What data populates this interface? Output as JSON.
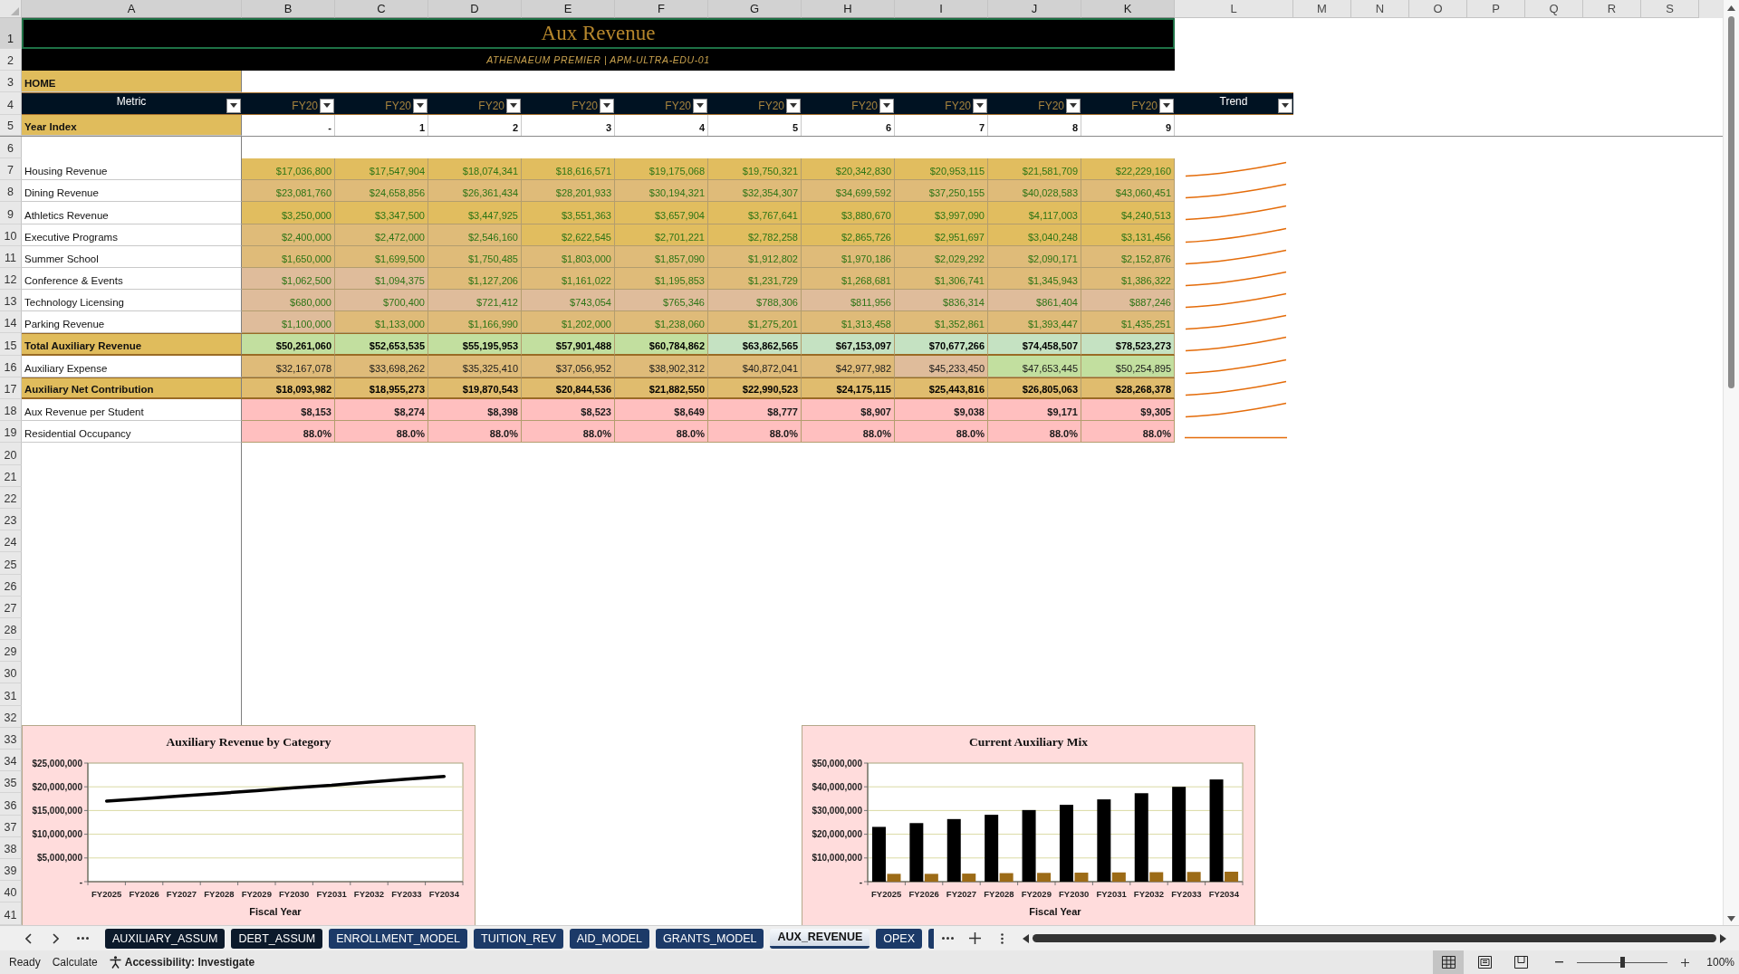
{
  "column_headers": [
    {
      "label": "A",
      "selected": true
    },
    {
      "label": "B",
      "selected": true
    },
    {
      "label": "C",
      "selected": true
    },
    {
      "label": "D",
      "selected": true
    },
    {
      "label": "E",
      "selected": true
    },
    {
      "label": "F",
      "selected": true
    },
    {
      "label": "G",
      "selected": true
    },
    {
      "label": "H",
      "selected": true
    },
    {
      "label": "I",
      "selected": true
    },
    {
      "label": "J",
      "selected": true
    },
    {
      "label": "K",
      "selected": true
    },
    {
      "label": "L",
      "selected": false
    },
    {
      "label": "M",
      "selected": false
    },
    {
      "label": "N",
      "selected": false
    },
    {
      "label": "O",
      "selected": false
    },
    {
      "label": "P",
      "selected": false
    },
    {
      "label": "Q",
      "selected": false
    },
    {
      "label": "R",
      "selected": false
    },
    {
      "label": "S",
      "selected": false
    }
  ],
  "row_headers": [
    {
      "label": "1",
      "selected": true
    },
    {
      "label": "2",
      "selected": false
    },
    {
      "label": "3",
      "selected": false
    },
    {
      "label": "4",
      "selected": false
    },
    {
      "label": "5",
      "selected": false
    },
    {
      "label": "6",
      "selected": false
    },
    {
      "label": "7",
      "selected": false
    },
    {
      "label": "8",
      "selected": false
    },
    {
      "label": "9",
      "selected": false
    },
    {
      "label": "10",
      "selected": false
    },
    {
      "label": "11",
      "selected": false
    },
    {
      "label": "12",
      "selected": false
    },
    {
      "label": "13",
      "selected": false
    },
    {
      "label": "14",
      "selected": false
    },
    {
      "label": "15",
      "selected": false
    },
    {
      "label": "16",
      "selected": false
    },
    {
      "label": "17",
      "selected": false
    },
    {
      "label": "18",
      "selected": false
    },
    {
      "label": "19",
      "selected": false
    },
    {
      "label": "20",
      "selected": false
    },
    {
      "label": "21",
      "selected": false
    },
    {
      "label": "22",
      "selected": false
    },
    {
      "label": "23",
      "selected": false
    },
    {
      "label": "24",
      "selected": false
    },
    {
      "label": "25",
      "selected": false
    },
    {
      "label": "26",
      "selected": false
    },
    {
      "label": "27",
      "selected": false
    },
    {
      "label": "28",
      "selected": false
    },
    {
      "label": "29",
      "selected": false
    },
    {
      "label": "30",
      "selected": false
    },
    {
      "label": "31",
      "selected": false
    },
    {
      "label": "32",
      "selected": false
    },
    {
      "label": "33",
      "selected": false
    },
    {
      "label": "34",
      "selected": false
    },
    {
      "label": "35",
      "selected": false
    },
    {
      "label": "36",
      "selected": false
    },
    {
      "label": "37",
      "selected": false
    },
    {
      "label": "38",
      "selected": false
    },
    {
      "label": "39",
      "selected": false
    },
    {
      "label": "40",
      "selected": false
    },
    {
      "label": "41",
      "selected": false
    }
  ],
  "title": {
    "text": "Aux Revenue",
    "selected": true
  },
  "subtitle": "ATHENAEUM PREMIER | APM-ULTRA-EDU-01",
  "home": "HOME",
  "table": {
    "metric_header": "Metric",
    "columns": [
      "FY20",
      "FY20",
      "FY20",
      "FY20",
      "FY20",
      "FY20",
      "FY20",
      "FY20",
      "FY20",
      "FY20"
    ],
    "trend_header": "Trend",
    "year_index": {
      "label": "Year Index",
      "values": [
        "-",
        "1",
        "2",
        "3",
        "4",
        "5",
        "6",
        "7",
        "8",
        "9"
      ]
    },
    "rows": [
      {
        "label": "Housing Revenue",
        "kind": "input",
        "trend_flat": false,
        "cells": [
          {
            "value": "$17,036,800",
            "color": "#e1bd5f"
          },
          {
            "value": "$17,547,904",
            "color": "#e1bd5f"
          },
          {
            "value": "$18,074,341",
            "color": "#e1bd5f"
          },
          {
            "value": "$18,616,571",
            "color": "#e1bd5f"
          },
          {
            "value": "$19,175,068",
            "color": "#e1bd5f"
          },
          {
            "value": "$19,750,321",
            "color": "#e1bd5f"
          },
          {
            "value": "$20,342,830",
            "color": "#e1bd5f"
          },
          {
            "value": "$20,953,115",
            "color": "#e1bd5f"
          },
          {
            "value": "$21,581,709",
            "color": "#e1bd5f"
          },
          {
            "value": "$22,229,160",
            "color": "#e1bd5f"
          }
        ]
      },
      {
        "label": "Dining Revenue",
        "kind": "input",
        "trend_flat": false,
        "cells": [
          {
            "value": "$23,081,760",
            "color": "#dfbb79"
          },
          {
            "value": "$24,658,856",
            "color": "#dfbb79"
          },
          {
            "value": "$26,361,434",
            "color": "#dfbb79"
          },
          {
            "value": "$28,201,933",
            "color": "#dfbb79"
          },
          {
            "value": "$30,194,321",
            "color": "#dfbb79"
          },
          {
            "value": "$32,354,307",
            "color": "#dfbb79"
          },
          {
            "value": "$34,699,592",
            "color": "#dfbb79"
          },
          {
            "value": "$37,250,155",
            "color": "#dfbb79"
          },
          {
            "value": "$40,028,583",
            "color": "#dfbb79"
          },
          {
            "value": "$43,060,451",
            "color": "#dfbb79"
          }
        ]
      },
      {
        "label": "Athletics Revenue",
        "kind": "input",
        "trend_flat": false,
        "cells": [
          {
            "value": "$3,250,000",
            "color": "#e1bd5f"
          },
          {
            "value": "$3,347,500",
            "color": "#e1bd5f"
          },
          {
            "value": "$3,447,925",
            "color": "#e1bd5f"
          },
          {
            "value": "$3,551,363",
            "color": "#e1bd5f"
          },
          {
            "value": "$3,657,904",
            "color": "#e1bd5f"
          },
          {
            "value": "$3,767,641",
            "color": "#e1bd5f"
          },
          {
            "value": "$3,880,670",
            "color": "#e1bd5f"
          },
          {
            "value": "$3,997,090",
            "color": "#e1bd5f"
          },
          {
            "value": "$4,117,003",
            "color": "#e1bd5f"
          },
          {
            "value": "$4,240,513",
            "color": "#e1bd5f"
          }
        ]
      },
      {
        "label": "Executive Programs",
        "kind": "input",
        "trend_flat": false,
        "cells": [
          {
            "value": "$2,400,000",
            "color": "#dfbb79"
          },
          {
            "value": "$2,472,000",
            "color": "#dfbb79"
          },
          {
            "value": "$2,546,160",
            "color": "#dfbb79"
          },
          {
            "value": "$2,622,545",
            "color": "#e1bd5f"
          },
          {
            "value": "$2,701,221",
            "color": "#e1bd5f"
          },
          {
            "value": "$2,782,258",
            "color": "#e1bd5f"
          },
          {
            "value": "$2,865,726",
            "color": "#e1bd5f"
          },
          {
            "value": "$2,951,697",
            "color": "#e1bd5f"
          },
          {
            "value": "$3,040,248",
            "color": "#e1bd5f"
          },
          {
            "value": "$3,131,456",
            "color": "#e1bd5f"
          }
        ]
      },
      {
        "label": "Summer School",
        "kind": "input",
        "trend_flat": false,
        "cells": [
          {
            "value": "$1,650,000",
            "color": "#dfbb79"
          },
          {
            "value": "$1,699,500",
            "color": "#dfbb79"
          },
          {
            "value": "$1,750,485",
            "color": "#dfbb79"
          },
          {
            "value": "$1,803,000",
            "color": "#dfbb79"
          },
          {
            "value": "$1,857,090",
            "color": "#dfbb79"
          },
          {
            "value": "$1,912,802",
            "color": "#dfbb79"
          },
          {
            "value": "$1,970,186",
            "color": "#dfbb79"
          },
          {
            "value": "$2,029,292",
            "color": "#dfbb79"
          },
          {
            "value": "$2,090,171",
            "color": "#dfbb79"
          },
          {
            "value": "$2,152,876",
            "color": "#dfbb79"
          }
        ]
      },
      {
        "label": "Conference & Events",
        "kind": "input",
        "trend_flat": false,
        "cells": [
          {
            "value": "$1,062,500",
            "color": "#dfbc9b"
          },
          {
            "value": "$1,094,375",
            "color": "#dfbc9b"
          },
          {
            "value": "$1,127,206",
            "color": "#dfbb79"
          },
          {
            "value": "$1,161,022",
            "color": "#dfbb79"
          },
          {
            "value": "$1,195,853",
            "color": "#dfbb79"
          },
          {
            "value": "$1,231,729",
            "color": "#dfbb79"
          },
          {
            "value": "$1,268,681",
            "color": "#dfbb79"
          },
          {
            "value": "$1,306,741",
            "color": "#dfbb79"
          },
          {
            "value": "$1,345,943",
            "color": "#dfbb79"
          },
          {
            "value": "$1,386,322",
            "color": "#dfbb79"
          }
        ]
      },
      {
        "label": "Technology Licensing",
        "kind": "input",
        "trend_flat": false,
        "cells": [
          {
            "value": "$680,000",
            "color": "#dfbc9b"
          },
          {
            "value": "$700,400",
            "color": "#dfbc9b"
          },
          {
            "value": "$721,412",
            "color": "#dfbc9b"
          },
          {
            "value": "$743,054",
            "color": "#dfbc9b"
          },
          {
            "value": "$765,346",
            "color": "#dfbc9b"
          },
          {
            "value": "$788,306",
            "color": "#dfbc9b"
          },
          {
            "value": "$811,956",
            "color": "#dfbc9b"
          },
          {
            "value": "$836,314",
            "color": "#dfbc9b"
          },
          {
            "value": "$861,404",
            "color": "#dfbc9b"
          },
          {
            "value": "$887,246",
            "color": "#dfbc9b"
          }
        ]
      },
      {
        "label": "Parking Revenue",
        "kind": "input",
        "trend_flat": false,
        "cells": [
          {
            "value": "$1,100,000",
            "color": "#dfbc9b"
          },
          {
            "value": "$1,133,000",
            "color": "#dfbb79"
          },
          {
            "value": "$1,166,990",
            "color": "#dfbb79"
          },
          {
            "value": "$1,202,000",
            "color": "#dfbb79"
          },
          {
            "value": "$1,238,060",
            "color": "#dfbb79"
          },
          {
            "value": "$1,275,201",
            "color": "#dfbb79"
          },
          {
            "value": "$1,313,458",
            "color": "#dfbb79"
          },
          {
            "value": "$1,352,861",
            "color": "#dfbb79"
          },
          {
            "value": "$1,393,447",
            "color": "#dfbb79"
          },
          {
            "value": "$1,435,251",
            "color": "#dfbb79"
          }
        ]
      },
      {
        "label": "Total Auxiliary Revenue",
        "kind": "total",
        "trend_flat": false,
        "cells": [
          {
            "value": "$50,261,060",
            "color": "#c2df9f"
          },
          {
            "value": "$52,653,535",
            "color": "#c2df9f"
          },
          {
            "value": "$55,195,953",
            "color": "#c2df9f"
          },
          {
            "value": "$57,901,488",
            "color": "#c2df9f"
          },
          {
            "value": "$60,784,862",
            "color": "#c2df9f"
          },
          {
            "value": "$63,862,565",
            "color": "#c5e2c2"
          },
          {
            "value": "$67,153,097",
            "color": "#c5e2c2"
          },
          {
            "value": "$70,677,266",
            "color": "#c5e2c2"
          },
          {
            "value": "$74,458,507",
            "color": "#c5e2c2"
          },
          {
            "value": "$78,523,273",
            "color": "#c5e2c2"
          }
        ]
      },
      {
        "label": "Auxiliary Expense",
        "kind": "calc",
        "trend_flat": false,
        "cells": [
          {
            "value": "$32,167,078",
            "color": "#dfbb79"
          },
          {
            "value": "$33,698,262",
            "color": "#dfbb79"
          },
          {
            "value": "$35,325,410",
            "color": "#dfbb79"
          },
          {
            "value": "$37,056,952",
            "color": "#dfbb79"
          },
          {
            "value": "$38,902,312",
            "color": "#dfbb79"
          },
          {
            "value": "$40,872,041",
            "color": "#dfbb79"
          },
          {
            "value": "$42,977,982",
            "color": "#dfbb79"
          },
          {
            "value": "$45,233,450",
            "color": "#dfbc9b"
          },
          {
            "value": "$47,653,445",
            "color": "#c2df9f"
          },
          {
            "value": "$50,254,895",
            "color": "#c2df9f"
          }
        ]
      },
      {
        "label": "Auxiliary Net Contribution",
        "kind": "total",
        "trend_flat": false,
        "cells": [
          {
            "value": "$18,093,982",
            "color": "#e0bc6e"
          },
          {
            "value": "$18,955,273",
            "color": "#e0bc6e"
          },
          {
            "value": "$19,870,543",
            "color": "#e0bc6e"
          },
          {
            "value": "$20,844,536",
            "color": "#e0bc6e"
          },
          {
            "value": "$21,882,550",
            "color": "#e0bc6e"
          },
          {
            "value": "$22,990,523",
            "color": "#e0bc6e"
          },
          {
            "value": "$24,175,115",
            "color": "#e0bc6e"
          },
          {
            "value": "$25,443,816",
            "color": "#e0bc6e"
          },
          {
            "value": "$26,805,063",
            "color": "#e0bc6e"
          },
          {
            "value": "$28,268,378",
            "color": "#e0bc6e"
          }
        ]
      },
      {
        "label": "Aux Revenue per Student",
        "kind": "metric",
        "trend_flat": false,
        "cells": [
          {
            "value": "$8,153",
            "color": "#ffbfbf"
          },
          {
            "value": "$8,274",
            "color": "#ffbfbf"
          },
          {
            "value": "$8,398",
            "color": "#ffbfbf"
          },
          {
            "value": "$8,523",
            "color": "#ffbfbf"
          },
          {
            "value": "$8,649",
            "color": "#ffbfbf"
          },
          {
            "value": "$8,777",
            "color": "#ffbfbf"
          },
          {
            "value": "$8,907",
            "color": "#ffbfbf"
          },
          {
            "value": "$9,038",
            "color": "#ffbfbf"
          },
          {
            "value": "$9,171",
            "color": "#ffbfbf"
          },
          {
            "value": "$9,305",
            "color": "#ffbfbf"
          }
        ]
      },
      {
        "label": "Residential Occupancy",
        "kind": "metric",
        "trend_flat": true,
        "cells": [
          {
            "value": "88.0%",
            "color": "#ffbfbf"
          },
          {
            "value": "88.0%",
            "color": "#ffbfbf"
          },
          {
            "value": "88.0%",
            "color": "#ffbfbf"
          },
          {
            "value": "88.0%",
            "color": "#ffbfbf"
          },
          {
            "value": "88.0%",
            "color": "#ffbfbf"
          },
          {
            "value": "88.0%",
            "color": "#ffbfbf"
          },
          {
            "value": "88.0%",
            "color": "#ffbfbf"
          },
          {
            "value": "88.0%",
            "color": "#ffbfbf"
          },
          {
            "value": "88.0%",
            "color": "#ffbfbf"
          },
          {
            "value": "88.0%",
            "color": "#ffbfbf"
          }
        ]
      }
    ]
  },
  "charts": [
    {
      "chart_data": {
        "type": "line",
        "title": "Auxiliary Revenue by Category",
        "xlabel": "Fiscal Year",
        "categories": [
          "FY2025",
          "FY2026",
          "FY2027",
          "FY2028",
          "FY2029",
          "FY2030",
          "FY2031",
          "FY2032",
          "FY2033",
          "FY2034"
        ],
        "series": [
          {
            "color": "#000000",
            "values": [
              17000000,
              17500000,
              18100000,
              18600000,
              19200000,
              19800000,
              20300000,
              21000000,
              21600000,
              22200000
            ]
          }
        ],
        "ylim": [
          0,
          25000000
        ],
        "yticks": [
          {
            "value": 0,
            "label": "-"
          },
          {
            "value": 5000000,
            "label": "$5,000,000"
          },
          {
            "value": 10000000,
            "label": "$10,000,000"
          },
          {
            "value": 15000000,
            "label": "$15,000,000"
          },
          {
            "value": 20000000,
            "label": "$20,000,000"
          },
          {
            "value": 25000000,
            "label": "$25,000,000"
          }
        ],
        "grid": true
      }
    },
    {
      "chart_data": {
        "type": "bar",
        "title": "Current Auxiliary Mix",
        "xlabel": "Fiscal Year",
        "categories": [
          "FY2025",
          "FY2026",
          "FY2027",
          "FY2028",
          "FY2029",
          "FY2030",
          "FY2031",
          "FY2032",
          "FY2033",
          "FY2034"
        ],
        "series": [
          {
            "color": "#000000",
            "values": [
              23100000,
              24700000,
              26400000,
              28200000,
              30200000,
              32400000,
              34700000,
              37300000,
              40000000,
              43100000
            ]
          },
          {
            "color": "#9c6b17",
            "values": [
              3300000,
              3300000,
              3400000,
              3600000,
              3700000,
              3800000,
              3900000,
              4000000,
              4100000,
              4200000
            ]
          }
        ],
        "ylim": [
          0,
          50000000
        ],
        "yticks": [
          {
            "value": 0,
            "label": "-"
          },
          {
            "value": 10000000,
            "label": "$10,000,000"
          },
          {
            "value": 20000000,
            "label": "$20,000,000"
          },
          {
            "value": 30000000,
            "label": "$30,000,000"
          },
          {
            "value": 40000000,
            "label": "$40,000,000"
          },
          {
            "value": 50000000,
            "label": "$50,000,000"
          }
        ],
        "grid": true
      }
    }
  ],
  "sheet_tabs": [
    {
      "label": "AUXILIARY_ASSUM",
      "color": "#0c1a2b",
      "selected": false
    },
    {
      "label": "DEBT_ASSUM",
      "color": "#0c1a2b",
      "selected": false
    },
    {
      "label": "ENROLLMENT_MODEL",
      "color": "#1c3a68",
      "selected": false
    },
    {
      "label": "TUITION_REV",
      "color": "#1c3a68",
      "selected": false
    },
    {
      "label": "AID_MODEL",
      "color": "#1c3a68",
      "selected": false
    },
    {
      "label": "GRANTS_MODEL",
      "color": "#1c3a68",
      "selected": false
    },
    {
      "label": "AUX_REVENUE",
      "color": "#1c3a68",
      "selected": true
    },
    {
      "label": "OPEX",
      "color": "#1c3a68",
      "selected": false
    }
  ],
  "status_bar": {
    "items": [
      "Ready",
      "Calculate"
    ],
    "accessibility": "Accessibility: Investigate",
    "views": [
      {
        "kind": "normal",
        "selected": true
      },
      {
        "kind": "page_layout",
        "selected": false
      },
      {
        "kind": "page_break",
        "selected": false
      }
    ],
    "zoom": {
      "level": 0.5,
      "reading": "100%"
    }
  }
}
